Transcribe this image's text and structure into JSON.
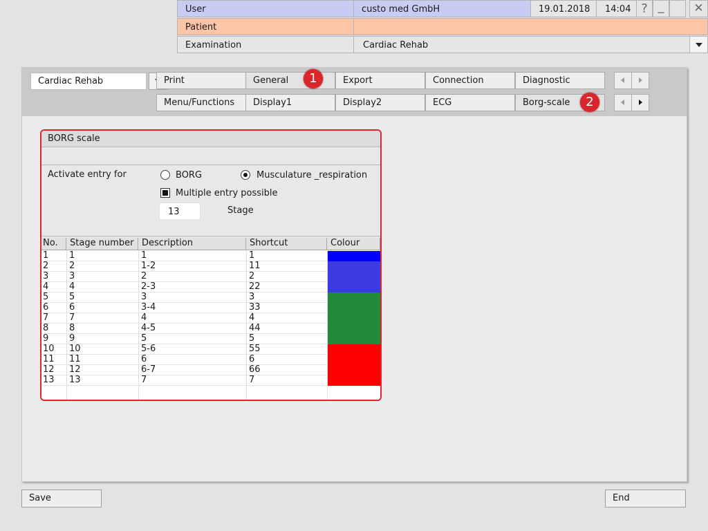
{
  "header": {
    "user_label": "User",
    "user_value": "custo med GmbH",
    "date": "19.01.2018",
    "time": "14:04",
    "patient_label": "Patient",
    "patient_value": "",
    "examination_label": "Examination",
    "examination_value": "Cardiac Rehab",
    "help_glyph": "?",
    "minimize_glyph": "_",
    "close_glyph": "✕"
  },
  "toolbar": {
    "selector_value": "Cardiac Rehab",
    "tabs_row1": [
      "Print",
      "General",
      "Export",
      "Connection",
      "Diagnostic"
    ],
    "tabs_row2": [
      "Menu/Functions",
      "Display1",
      "Display2",
      "ECG",
      "Borg-scale"
    ],
    "active_tab": "Borg-scale"
  },
  "annotations": {
    "badge1": "1",
    "badge2": "2"
  },
  "borg": {
    "title": "BORG scale",
    "activate_label": "Activate entry for",
    "option_borg": "BORG",
    "option_musc": "Musculature _respiration",
    "selected_option": "Musculature _respiration",
    "multiple_label": "Multiple entry possible",
    "multiple_checked": true,
    "stage_value": "13",
    "stage_label": "Stage",
    "columns": [
      "No.",
      "Stage number",
      "Description",
      "Shortcut",
      "Colour"
    ],
    "rows": [
      {
        "no": "1",
        "stage": "1",
        "desc": "1",
        "shortcut": "1",
        "colour": "#0000ff"
      },
      {
        "no": "2",
        "stage": "2",
        "desc": "1-2",
        "shortcut": "11",
        "colour": "#3b3be0"
      },
      {
        "no": "3",
        "stage": "3",
        "desc": "2",
        "shortcut": "2",
        "colour": "#3b3be0"
      },
      {
        "no": "4",
        "stage": "4",
        "desc": "2-3",
        "shortcut": "22",
        "colour": "#3b3be0"
      },
      {
        "no": "5",
        "stage": "5",
        "desc": "3",
        "shortcut": "3",
        "colour": "#228b3a"
      },
      {
        "no": "6",
        "stage": "6",
        "desc": "3-4",
        "shortcut": "33",
        "colour": "#228b3a"
      },
      {
        "no": "7",
        "stage": "7",
        "desc": "4",
        "shortcut": "4",
        "colour": "#228b3a"
      },
      {
        "no": "8",
        "stage": "8",
        "desc": "4-5",
        "shortcut": "44",
        "colour": "#228b3a"
      },
      {
        "no": "9",
        "stage": "9",
        "desc": "5",
        "shortcut": "5",
        "colour": "#228b3a"
      },
      {
        "no": "10",
        "stage": "10",
        "desc": "5-6",
        "shortcut": "55",
        "colour": "#ff0000"
      },
      {
        "no": "11",
        "stage": "11",
        "desc": "6",
        "shortcut": "6",
        "colour": "#ff0000"
      },
      {
        "no": "12",
        "stage": "12",
        "desc": "6-7",
        "shortcut": "66",
        "colour": "#ff0000"
      },
      {
        "no": "13",
        "stage": "13",
        "desc": "7",
        "shortcut": "7",
        "colour": "#ff0000"
      }
    ]
  },
  "footer": {
    "save_label": "Save",
    "end_label": "End"
  },
  "colors": {
    "header_user_bg": "#c8cbf2",
    "header_patient_bg": "#fcc5a8",
    "highlight_border": "#e0252c"
  }
}
